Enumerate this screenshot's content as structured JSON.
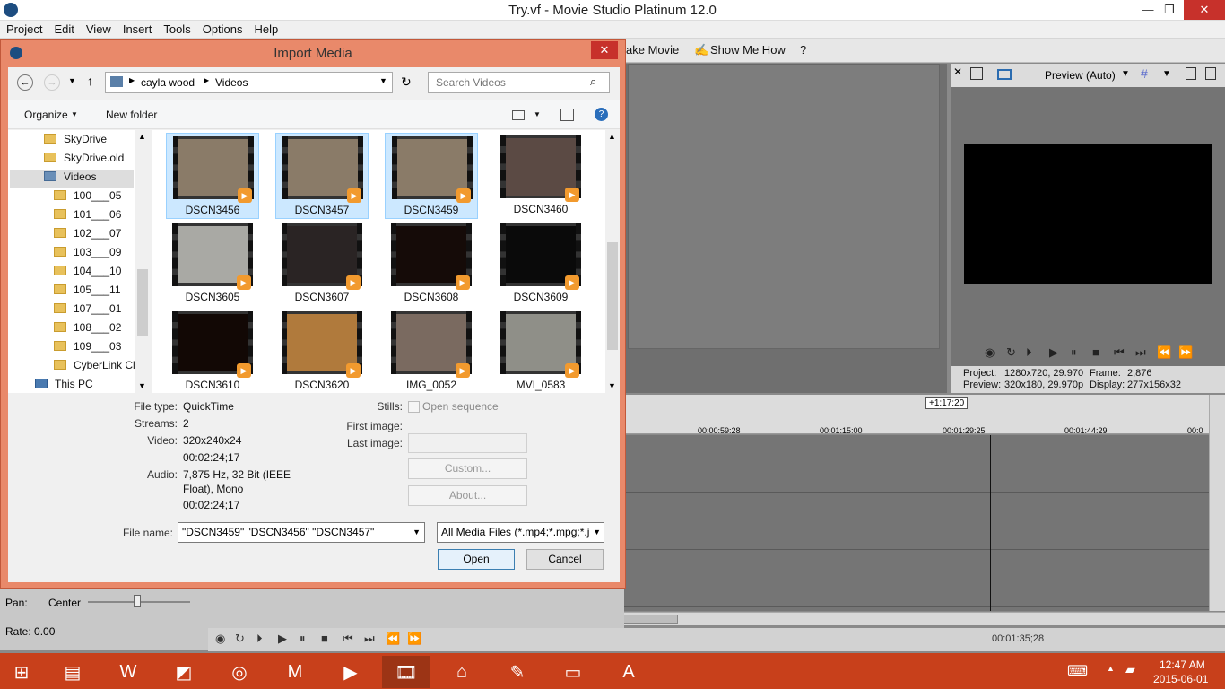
{
  "app": {
    "title": "Try.vf - Movie Studio Platinum 12.0",
    "minimize": "—",
    "restore": "❐",
    "close": "✕"
  },
  "menu": [
    "Project",
    "Edit",
    "View",
    "Insert",
    "Tools",
    "Options",
    "Help"
  ],
  "toolbar": {
    "make_movie": "ake Movie",
    "show_me_how": "Show Me How"
  },
  "preview": {
    "mode": "Preview (Auto)",
    "project_label": "Project:",
    "project_value": "1280x720, 29.970",
    "frame_label": "Frame:",
    "frame_value": "2,876",
    "preview_label": "Preview:",
    "preview_value": "320x180, 29.970p",
    "display_label": "Display:",
    "display_value": "277x156x32"
  },
  "timeline": {
    "marker": "+1:17:20",
    "ticks": [
      "00:00:59:28",
      "00:01:15:00",
      "00:01:29:25",
      "00:01:44:29",
      "00:0"
    ],
    "cursor_time": "00:01:35;28"
  },
  "left_panel": {
    "pan_label": "Pan:",
    "pan_value": "Center",
    "rate_label": "Rate: 0.00"
  },
  "dialog": {
    "title": "Import Media",
    "close": "✕",
    "breadcrumb": [
      "cayla wood",
      "Videos"
    ],
    "search_placeholder": "Search Videos",
    "organize": "Organize",
    "new_folder": "New folder",
    "nav_items": [
      {
        "label": "SkyDrive",
        "level": 1
      },
      {
        "label": "SkyDrive.old",
        "level": 1
      },
      {
        "label": "Videos",
        "level": 1,
        "selected": true
      },
      {
        "label": "100___05",
        "level": 2
      },
      {
        "label": "101___06",
        "level": 2
      },
      {
        "label": "102___07",
        "level": 2
      },
      {
        "label": "103___09",
        "level": 2
      },
      {
        "label": "104___10",
        "level": 2
      },
      {
        "label": "105___11",
        "level": 2
      },
      {
        "label": "107___01",
        "level": 2
      },
      {
        "label": "108___02",
        "level": 2
      },
      {
        "label": "109___03",
        "level": 2
      },
      {
        "label": "CyberLink Clc",
        "level": 2
      },
      {
        "label": "This PC",
        "level": 0
      }
    ],
    "files": [
      {
        "name": "DSCN3456",
        "selected": true,
        "tone": "#8a7b68"
      },
      {
        "name": "DSCN3457",
        "selected": true,
        "tone": "#8a7b68"
      },
      {
        "name": "DSCN3459",
        "selected": true,
        "tone": "#8a7b68"
      },
      {
        "name": "DSCN3460",
        "selected": false,
        "tone": "#5b4a44"
      },
      {
        "name": "DSCN3605",
        "selected": false,
        "tone": "#a9a9a4"
      },
      {
        "name": "DSCN3607",
        "selected": false,
        "tone": "#2a2424"
      },
      {
        "name": "DSCN3608",
        "selected": false,
        "tone": "#150b08"
      },
      {
        "name": "DSCN3609",
        "selected": false,
        "tone": "#0a0a0a"
      },
      {
        "name": "DSCN3610",
        "selected": false,
        "tone": "#120805"
      },
      {
        "name": "DSCN3620",
        "selected": false,
        "tone": "#b07a3c"
      },
      {
        "name": "IMG_0052",
        "selected": false,
        "tone": "#7a6a60"
      },
      {
        "name": "MVI_0583",
        "selected": false,
        "tone": "#8f8f88"
      }
    ],
    "details": {
      "file_type_label": "File type:",
      "file_type": "QuickTime",
      "streams_label": "Streams:",
      "streams": "2",
      "video_label": "Video:",
      "video": "320x240x24",
      "video_dur": "00:02:24;17",
      "audio_label": "Audio:",
      "audio1": "7,875 Hz, 32 Bit (IEEE",
      "audio2": "Float), Mono",
      "audio_dur": "00:02:24;17",
      "stills_label": "Stills:",
      "open_sequence": "Open sequence",
      "first_image_label": "First image:",
      "last_image_label": "Last image:",
      "custom_button": "Custom...",
      "about_button": "About..."
    },
    "file_name_label": "File name:",
    "file_name": "\"DSCN3459\" \"DSCN3456\" \"DSCN3457\"",
    "file_type_filter": "All Media Files (*.mp4;*.mpg;*.j",
    "open_button": "Open",
    "cancel_button": "Cancel"
  },
  "taskbar": {
    "time": "12:47 AM",
    "date": "2015-06-01"
  }
}
